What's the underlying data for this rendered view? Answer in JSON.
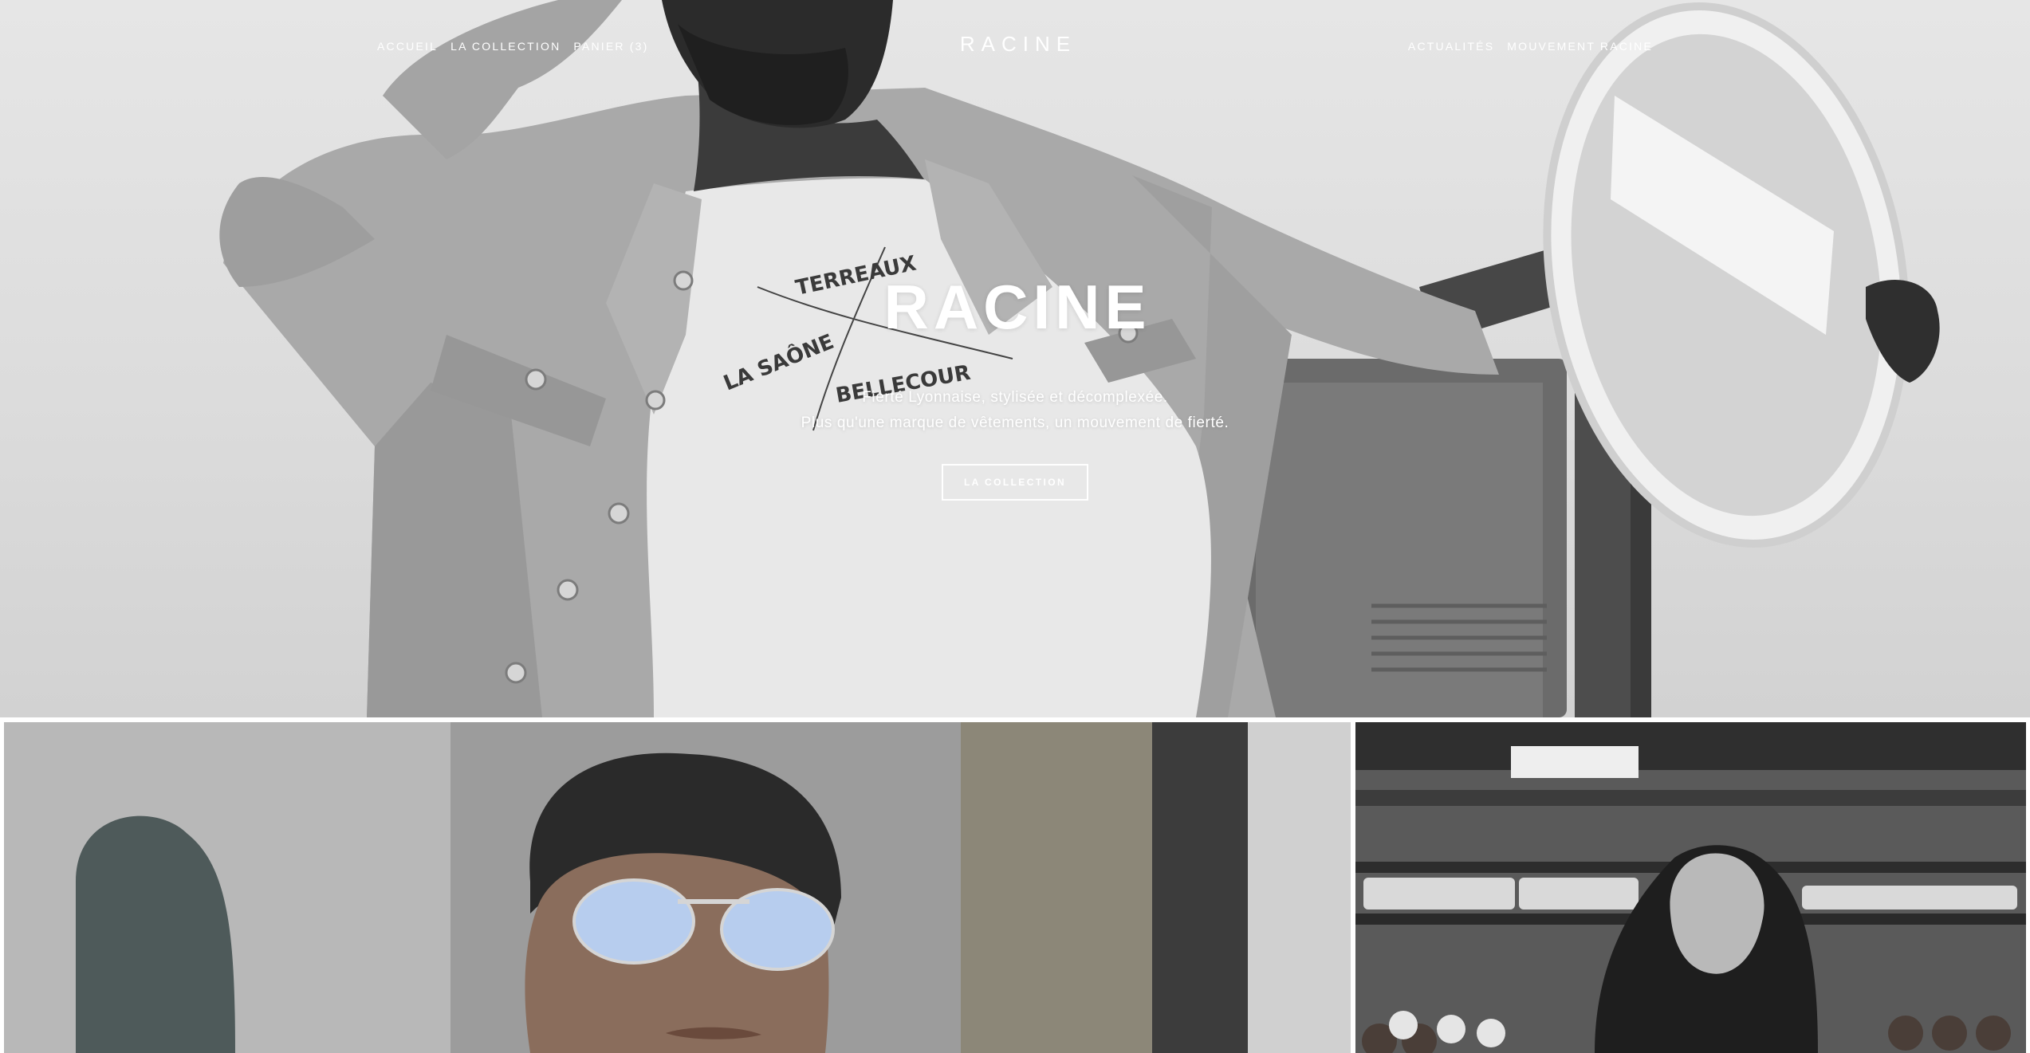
{
  "brand": {
    "logo": "RACINE"
  },
  "nav": {
    "left": [
      {
        "label": "ACCUEIL"
      },
      {
        "label": "LA COLLECTION"
      },
      {
        "label": "PANIER (3)"
      }
    ],
    "right": [
      {
        "label": "ACTUALITÉS"
      },
      {
        "label": "MOUVEMENT RACINE"
      }
    ]
  },
  "hero": {
    "title": "RACINE",
    "subtitle_line1": "Fierté Lyonnaise, stylisée et décomplexée.",
    "subtitle_line2": "Plus qu'une marque de vêtements, un mouvement de fierté.",
    "cta_label": "LA COLLECTION",
    "shirt_print": [
      "TERREAUX",
      "LA SAÔNE",
      "BELLECOUR"
    ]
  },
  "gallery": [
    {
      "name": "man-with-sunglasses-photo"
    },
    {
      "name": "woman-in-bakery-photo"
    }
  ]
}
